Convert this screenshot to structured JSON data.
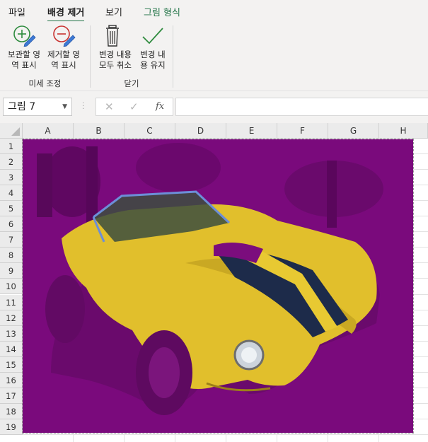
{
  "tabs": [
    "파일",
    "배경 제거",
    "보기",
    "그림 형식"
  ],
  "ribbon": {
    "keep_label": "보관할 영\n역 표시",
    "remove_label": "제거할 영\n역 표시",
    "discard_label": "변경 내용\n모두 취소",
    "keepchanges_label": "변경 내\n용 유지",
    "group_refine": "미세 조정",
    "group_close": "닫기"
  },
  "formula_bar": {
    "name_box": "그림 7",
    "cancel": "✕",
    "enter": "✓",
    "fx": "fx",
    "value": ""
  },
  "sheet": {
    "columns": [
      "A",
      "B",
      "C",
      "D",
      "E",
      "F",
      "G",
      "H"
    ],
    "rows": [
      "1",
      "2",
      "3",
      "4",
      "5",
      "6",
      "7",
      "8",
      "9",
      "10",
      "11",
      "12",
      "13",
      "14",
      "15",
      "16",
      "17",
      "18",
      "19"
    ]
  },
  "colors": {
    "accent": "#217346",
    "remove_overlay": "#800080",
    "car": "#e3c22c"
  },
  "icons": {
    "keep": "plus-pencil-icon",
    "remove": "minus-pencil-icon",
    "discard": "trash-icon",
    "keepchanges": "checkmark-icon"
  }
}
